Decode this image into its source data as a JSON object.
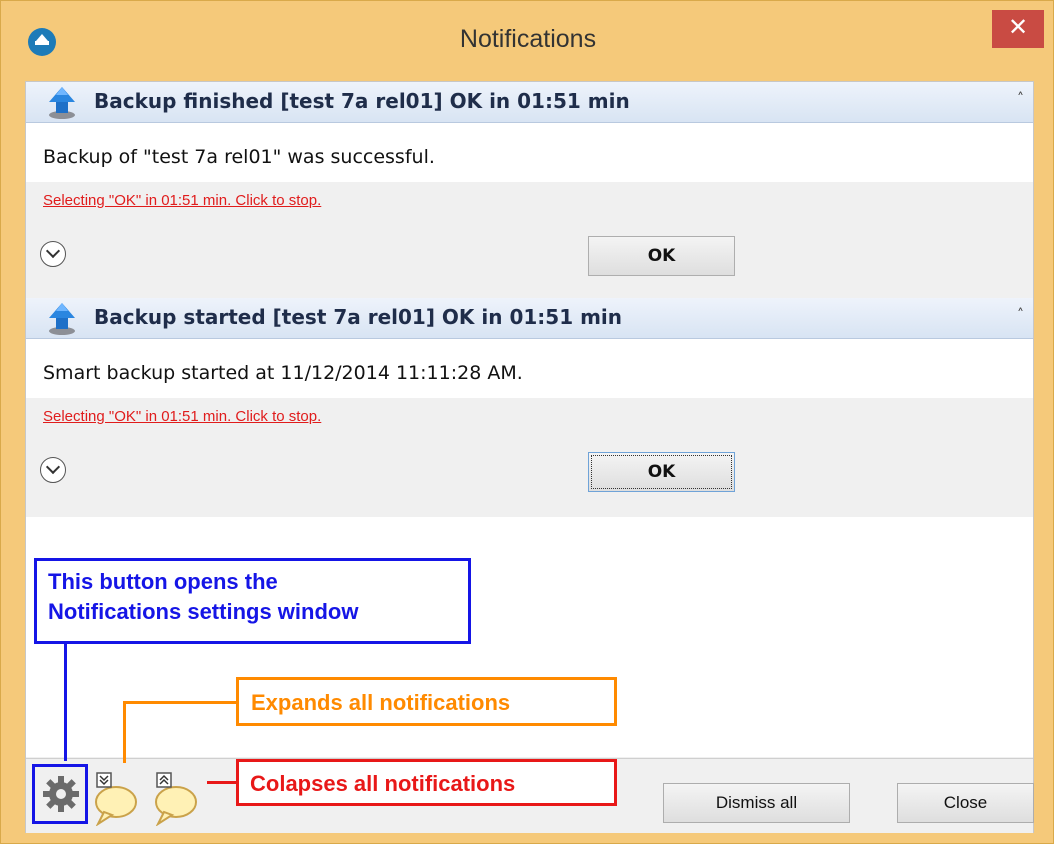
{
  "window": {
    "title": "Notifications",
    "close_glyph": "✕"
  },
  "notifications": [
    {
      "title": "Backup finished [test 7a rel01] OK in 01:51 min",
      "message": "Backup of \"test 7a rel01\" was successful.",
      "countdown_link": "Selecting \"OK\" in 01:51 min. Click to stop.",
      "ok_label": "OK",
      "collapse_glyph": "˄"
    },
    {
      "title": "Backup started [test 7a rel01] OK in 01:51 min",
      "message": "Smart backup started at 11/12/2014 11:11:28 AM.",
      "countdown_link": "Selecting \"OK\" in 01:51 min. Click to stop.",
      "ok_label": "OK",
      "collapse_glyph": "˄"
    }
  ],
  "footer": {
    "dismiss_all_label": "Dismiss all",
    "close_label": "Close"
  },
  "annotations": {
    "settings_note_line1": "This button opens the",
    "settings_note_line2": "Notifications settings window",
    "expand_note": "Expands all notifications",
    "collapse_note": "Colapses all notifications"
  },
  "colors": {
    "annotation_blue": "#1515e6",
    "annotation_orange": "#ff8a00",
    "annotation_red": "#e81818",
    "link_red": "#e01c1c",
    "close_button": "#c94b43"
  },
  "icons": [
    "app-icon",
    "upload-arrow-icon",
    "chevron-down-icon",
    "gear-icon",
    "expand-all-bubble-icon",
    "collapse-all-bubble-icon",
    "close-icon"
  ]
}
